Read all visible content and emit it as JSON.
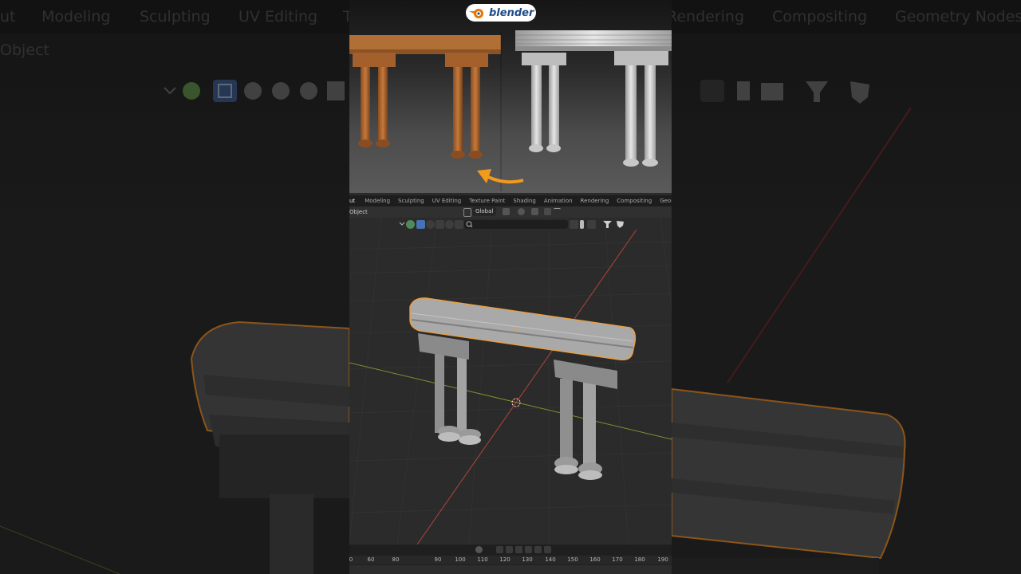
{
  "background": {
    "tabs": [
      "ut",
      "Modeling",
      "Sculpting",
      "UV Editing",
      "T",
      "Rendering",
      "Compositing",
      "Geometry Nodes"
    ],
    "object_label": "Object"
  },
  "logo": {
    "text": "blender"
  },
  "blender": {
    "workspace_tabs": [
      "ut",
      "Modeling",
      "Sculpting",
      "UV Editing",
      "Texture Paint",
      "Shading",
      "Animation",
      "Rendering",
      "Compositing",
      "Geometry Nodes"
    ],
    "active_tab": "ut",
    "mode_label": "Object",
    "orientation": "Global",
    "timeline_ticks": [
      "0",
      "60",
      "80",
      "90",
      "100",
      "110",
      "120",
      "130",
      "140",
      "150",
      "160",
      "170",
      "180",
      "190"
    ]
  },
  "colors": {
    "accent": "#4772b3",
    "selection_outline": "#e8a040",
    "arrow": "#f29a1c",
    "x_axis": "#b0443e",
    "y_axis": "#7d8f2d"
  },
  "icons": [
    "blender-logo-icon",
    "arrow-icon",
    "3d-cursor-icon",
    "filter-icon",
    "bookmark-icon",
    "shield-icon"
  ]
}
